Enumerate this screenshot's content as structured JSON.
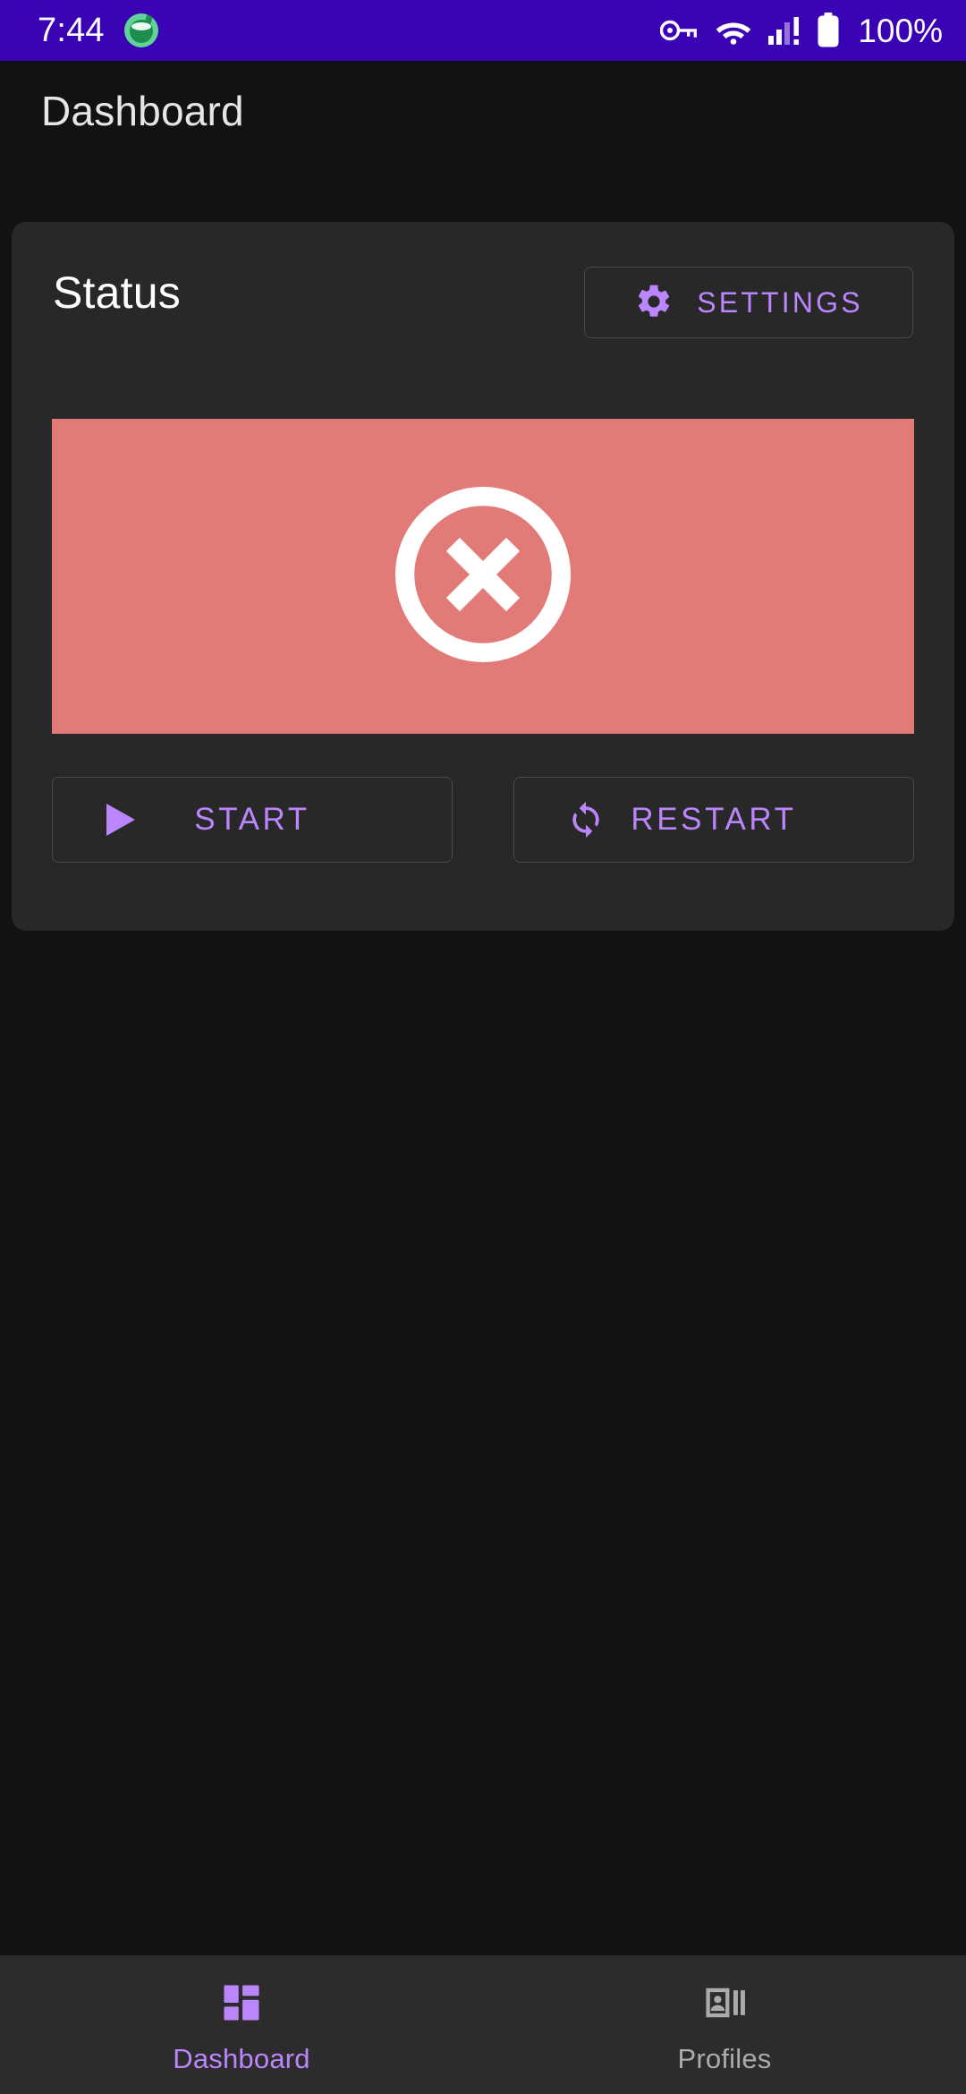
{
  "theme": {
    "page_background": "#121212",
    "card_background": "#282828",
    "status_bar_background": "#3A04B5",
    "accent_purple": "#BB86FC",
    "error_banner": "#E27A77",
    "nav_background": "#2C2C2C",
    "inactive_nav": "#ABABAB",
    "outline": "#4A4A4A"
  },
  "status_bar": {
    "clock": "7:44",
    "app_notification_icon": "green-flask-app-icon",
    "icons": [
      "vpn-key-icon",
      "wifi-icon",
      "cellular-signal-alert-icon",
      "battery-full-icon"
    ],
    "battery_text": "100%"
  },
  "app_bar": {
    "title": "Dashboard"
  },
  "status_card": {
    "title": "Status",
    "settings_button": {
      "label": "SETTINGS",
      "icon": "gear-icon"
    },
    "state_banner": {
      "icon": "error-circle-x-icon",
      "state": "stopped",
      "background": "#E27A77",
      "icon_color": "#FFFFFF"
    },
    "actions": [
      {
        "label": "START",
        "icon": "play-icon"
      },
      {
        "label": "RESTART",
        "icon": "sync-restart-icon"
      }
    ]
  },
  "bottom_nav": {
    "items": [
      {
        "label": "Dashboard",
        "icon": "dashboard-grid-icon",
        "active": true
      },
      {
        "label": "Profiles",
        "icon": "contacts-card-icon",
        "active": false
      }
    ]
  }
}
